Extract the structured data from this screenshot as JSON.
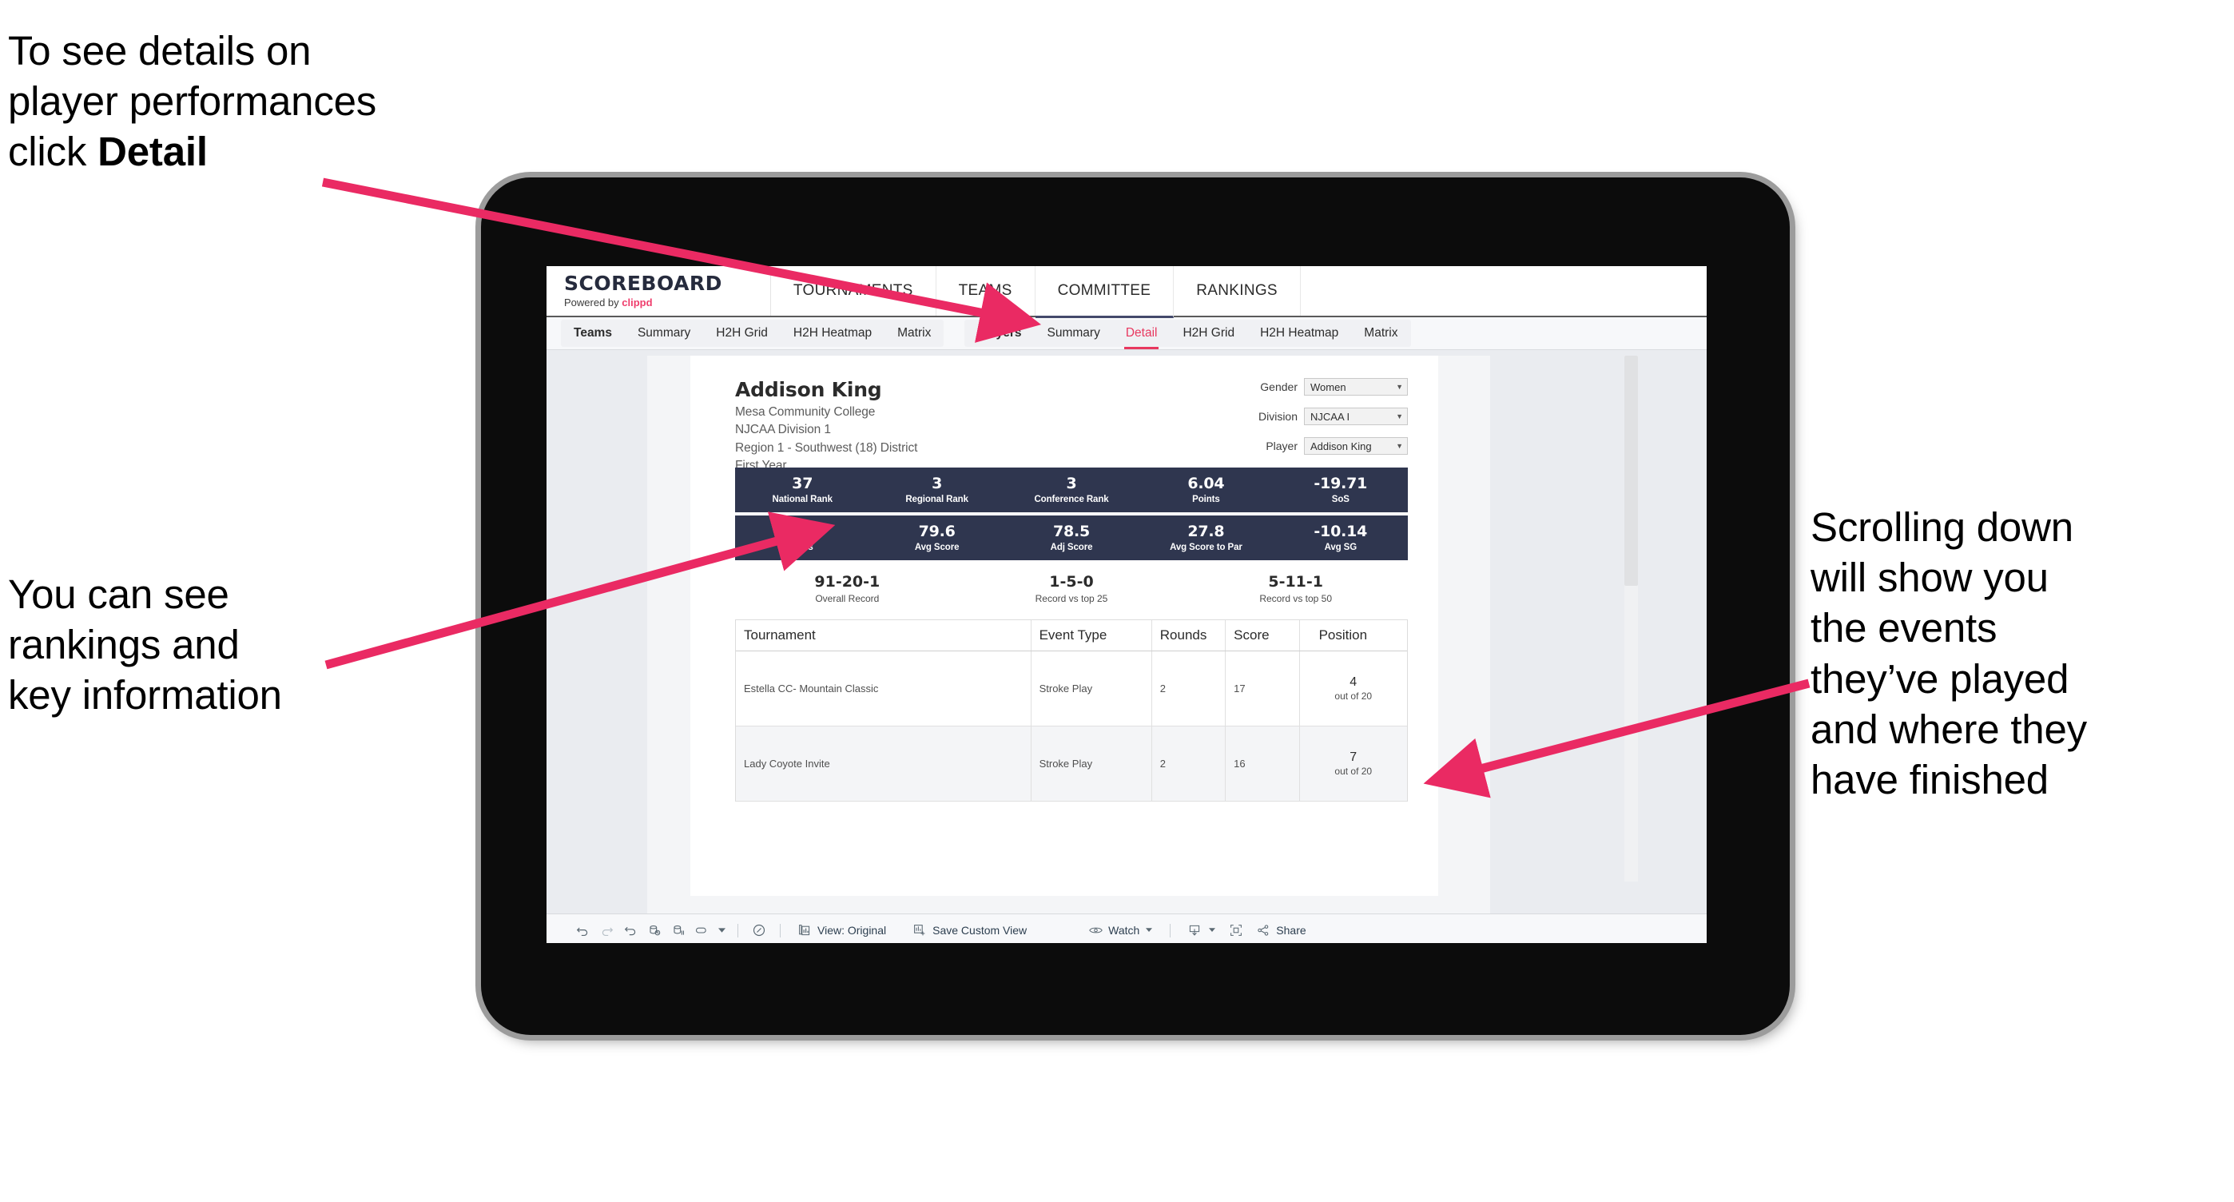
{
  "callouts": {
    "detail": {
      "line1": "To see details on",
      "line2": "player performances",
      "line3_pre": "click ",
      "line3_bold": "Detail"
    },
    "rankings": {
      "line1": "You can see",
      "line2": "rankings and",
      "line3": "key information"
    },
    "scrolling": {
      "line1": "Scrolling down",
      "line2": "will show you",
      "line3": "the events",
      "line4": "they’ve played",
      "line5": "and where they",
      "line6": "have finished"
    },
    "accent_color": "#ea2a63"
  },
  "app": {
    "brand": {
      "title": "SCOREBOARD",
      "sub_prefix": "Powered by ",
      "sub_brand": "clippd"
    },
    "topnav": [
      {
        "label": "TOURNAMENTS",
        "selected": false
      },
      {
        "label": "TEAMS",
        "selected": false
      },
      {
        "label": "COMMITTEE",
        "selected": true
      },
      {
        "label": "RANKINGS",
        "selected": false
      }
    ],
    "subnav": {
      "group_teams": [
        {
          "label": "Teams",
          "head": true,
          "active": false
        },
        {
          "label": "Summary",
          "head": false,
          "active": false
        },
        {
          "label": "H2H Grid",
          "head": false,
          "active": false
        },
        {
          "label": "H2H Heatmap",
          "head": false,
          "active": false
        },
        {
          "label": "Matrix",
          "head": false,
          "active": false
        }
      ],
      "group_players": [
        {
          "label": "Players",
          "head": true,
          "active": false
        },
        {
          "label": "Summary",
          "head": false,
          "active": false
        },
        {
          "label": "Detail",
          "head": false,
          "active": true
        },
        {
          "label": "H2H Grid",
          "head": false,
          "active": false
        },
        {
          "label": "H2H Heatmap",
          "head": false,
          "active": false
        },
        {
          "label": "Matrix",
          "head": false,
          "active": false
        }
      ],
      "active_color": "#e8385f"
    },
    "player": {
      "name": "Addison King",
      "school": "Mesa Community College",
      "division": "NJCAA Division 1",
      "region": "Region 1 - Southwest (18) District",
      "year": "First Year"
    },
    "filters": [
      {
        "label": "Gender",
        "value": "Women"
      },
      {
        "label": "Division",
        "value": "NJCAA I"
      },
      {
        "label": "Player",
        "value": "Addison King"
      }
    ],
    "stats_row1": [
      {
        "value": "37",
        "label": "National Rank"
      },
      {
        "value": "3",
        "label": "Regional Rank"
      },
      {
        "value": "3",
        "label": "Conference Rank"
      },
      {
        "value": "6.04",
        "label": "Points"
      },
      {
        "value": "-19.71",
        "label": "SoS"
      }
    ],
    "stats_row2": [
      {
        "value": "0",
        "label": "Wins"
      },
      {
        "value": "79.6",
        "label": "Avg Score"
      },
      {
        "value": "78.5",
        "label": "Adj Score"
      },
      {
        "value": "27.8",
        "label": "Avg Score to Par"
      },
      {
        "value": "-10.14",
        "label": "Avg SG"
      }
    ],
    "records": [
      {
        "value": "91-20-1",
        "label": "Overall Record"
      },
      {
        "value": "1-5-0",
        "label": "Record vs top 25"
      },
      {
        "value": "5-11-1",
        "label": "Record vs top 50"
      }
    ],
    "table": {
      "headers": [
        "Tournament",
        "Event Type",
        "Rounds",
        "Score",
        "Position"
      ],
      "rows": [
        {
          "tournament": "Estella CC- Mountain Classic",
          "event_type": "Stroke Play",
          "rounds": "2",
          "score": "17",
          "position": "4",
          "position_sub": "out of 20"
        },
        {
          "tournament": "Lady Coyote Invite",
          "event_type": "Stroke Play",
          "rounds": "2",
          "score": "16",
          "position": "7",
          "position_sub": "out of 20"
        }
      ]
    },
    "bottombar": {
      "view_label": "View: Original",
      "save_label": "Save Custom View",
      "watch_label": "Watch",
      "share_label": "Share"
    },
    "stat_bar_color": "#2f364f"
  }
}
